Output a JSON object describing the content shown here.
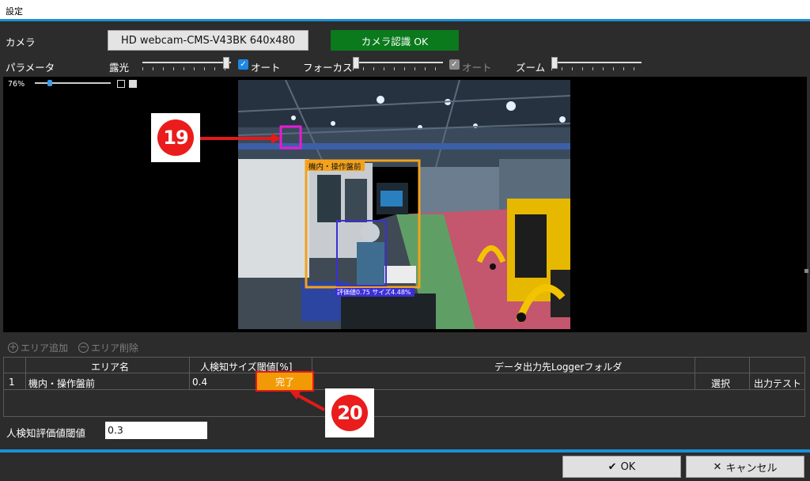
{
  "window": {
    "title": "設定"
  },
  "camera": {
    "label": "カメラ",
    "device": "HD webcam-CMS-V43BK  640x480",
    "status": "カメラ認識 OK"
  },
  "parameters": {
    "label": "パラメータ",
    "exposure": {
      "label": "露光",
      "auto_checked": true,
      "auto_label": "オート",
      "level": 0.98
    },
    "focus": {
      "label": "フォーカス",
      "auto_checked": true,
      "auto_disabled": true,
      "auto_label": "オート",
      "level": 0.0
    },
    "zoom": {
      "label": "ズーム",
      "level": 0.0
    }
  },
  "viewer": {
    "zoom_text": "76%",
    "zoom_level": 0.2
  },
  "overlay": {
    "area_label": "機内・操作盤前",
    "detection_label": "評価値0.75 サイズ4.48%"
  },
  "area_toolbar": {
    "add": "エリア追加",
    "remove": "エリア削除"
  },
  "table": {
    "headers": {
      "name": "エリア名",
      "threshold": "人検知サイズ閾値[%]",
      "folder": "データ出力先Loggerフォルダ"
    },
    "rows": [
      {
        "index": "1",
        "name": "機内・操作盤前",
        "threshold": "0.4",
        "done": "完了",
        "select": "選択",
        "test": "出力テスト"
      }
    ]
  },
  "eval_threshold": {
    "label": "人検知評価値閾値",
    "value": "0.3"
  },
  "footer": {
    "ok": "OK",
    "cancel": "キャンセル"
  },
  "callouts": {
    "c19": "19",
    "c20": "20"
  },
  "colors": {
    "accent": "#1a8fd6",
    "ok_green": "#0a7a1c",
    "done_orange": "#f29a05",
    "callout_red": "#ea1c1c",
    "area_orange": "#f3a21c",
    "person_blue": "#3b2fd6",
    "magenta": "#e81ad8"
  }
}
